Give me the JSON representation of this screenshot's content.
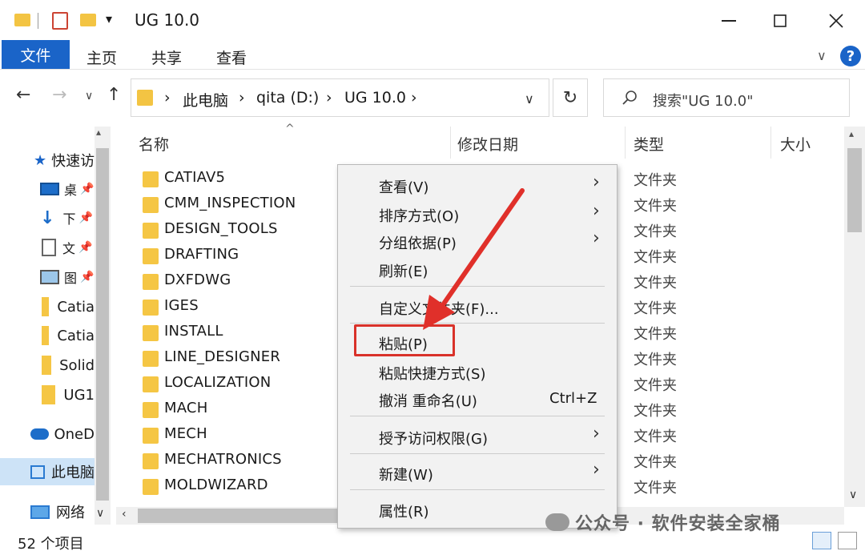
{
  "window": {
    "title": "UG 10.0",
    "quick_access_dropdown": "▾"
  },
  "ribbon": {
    "tabs": [
      "文件",
      "主页",
      "共享",
      "查看"
    ]
  },
  "address": {
    "path": [
      "此电脑",
      "qita (D:)",
      "UG 10.0"
    ],
    "search_placeholder": "搜索\"UG 10.0\""
  },
  "sidebar": {
    "items": [
      {
        "label": "快速访",
        "icon": "star-icon"
      },
      {
        "label": "桌",
        "icon": "desktop-icon"
      },
      {
        "label": "下",
        "icon": "download-icon"
      },
      {
        "label": "文",
        "icon": "document-icon"
      },
      {
        "label": "图",
        "icon": "picture-icon"
      },
      {
        "label": "Catia",
        "icon": "folder-icon"
      },
      {
        "label": "Catia",
        "icon": "folder-icon"
      },
      {
        "label": "Solid",
        "icon": "folder-icon"
      },
      {
        "label": "UG1",
        "icon": "folder-icon"
      },
      {
        "label": "OneD",
        "icon": "cloud-icon"
      },
      {
        "label": "此电脑",
        "icon": "computer-icon"
      },
      {
        "label": "网络",
        "icon": "network-icon"
      }
    ]
  },
  "columns": [
    "名称",
    "修改日期",
    "类型",
    "大小"
  ],
  "files": [
    {
      "name": "CATIAV5",
      "type": "文件夹"
    },
    {
      "name": "CMM_INSPECTION",
      "type": "文件夹"
    },
    {
      "name": "DESIGN_TOOLS",
      "type": "文件夹"
    },
    {
      "name": "DRAFTING",
      "type": "文件夹"
    },
    {
      "name": "DXFDWG",
      "type": "文件夹"
    },
    {
      "name": "IGES",
      "type": "文件夹"
    },
    {
      "name": "INSTALL",
      "type": "文件夹"
    },
    {
      "name": "LINE_DESIGNER",
      "type": "文件夹"
    },
    {
      "name": "LOCALIZATION",
      "type": "文件夹"
    },
    {
      "name": "MACH",
      "type": "文件夹"
    },
    {
      "name": "MECH",
      "type": "文件夹"
    },
    {
      "name": "MECHATRONICS",
      "type": "文件夹"
    },
    {
      "name": "MOLDWIZARD",
      "type": "文件夹"
    }
  ],
  "status": "52 个项目",
  "context_menu": {
    "items": [
      {
        "label": "查看(V)",
        "submenu": true
      },
      {
        "label": "排序方式(O)",
        "submenu": true
      },
      {
        "label": "分组依据(P)",
        "submenu": true
      },
      {
        "label": "刷新(E)",
        "submenu": false
      },
      {
        "label": "自定义文件夹(F)...",
        "submenu": false
      },
      {
        "label": "粘贴(P)",
        "submenu": false,
        "highlighted": true
      },
      {
        "label": "粘贴快捷方式(S)",
        "submenu": false
      },
      {
        "label": "撤消 重命名(U)",
        "shortcut": "Ctrl+Z",
        "submenu": false
      },
      {
        "label": "授予访问权限(G)",
        "submenu": true
      },
      {
        "label": "新建(W)",
        "submenu": true
      },
      {
        "label": "属性(R)",
        "submenu": false
      }
    ]
  },
  "watermark": "公众号 · 软件安装全家桶",
  "colors": {
    "accent": "#1a64c8",
    "highlight_box": "#d9322a",
    "folder": "#f5c644"
  }
}
